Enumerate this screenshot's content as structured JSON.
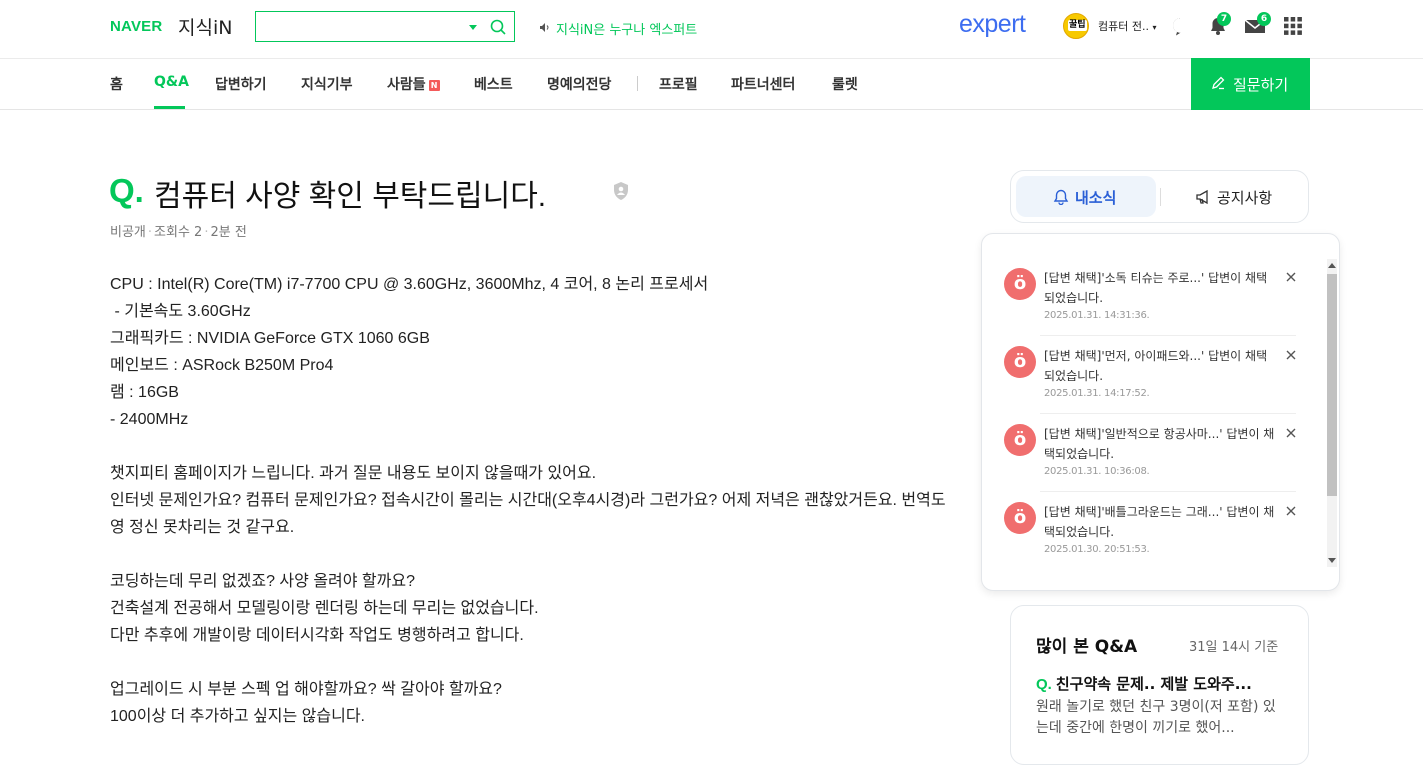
{
  "header": {
    "logo_naver": "NAVER",
    "logo_service": "지식iN",
    "search_placeholder": "",
    "notice": "지식iN은 누구나 엑스퍼트",
    "expert": "expert",
    "avatar_text": "꿀팁",
    "username": "컴퓨터 전..",
    "notification_count": "7",
    "mail_count": "6"
  },
  "nav": {
    "items": [
      "홈",
      "Q&A",
      "답변하기",
      "지식기부",
      "사람들",
      "베스트",
      "명예의전당",
      "프로필",
      "파트너센터",
      "룰렛"
    ],
    "new_badge": "N",
    "ask_button": "질문하기"
  },
  "question": {
    "mark": "Q.",
    "title": "컴퓨터 사양 확인 부탁드립니다.",
    "visibility": "비공개",
    "views": "조회수 2",
    "time": "2분 전",
    "body": [
      "CPU : Intel(R) Core(TM) i7-7700 CPU @ 3.60GHz, 3600Mhz, 4 코어, 8 논리 프로세서",
      " - 기본속도 3.60GHz",
      "그래픽카드 : NVIDIA GeForce GTX 1060 6GB",
      "메인보드 : ASRock B250M Pro4",
      "램 : 16GB",
      "- 2400MHz",
      "",
      "챗지피티 홈페이지가 느립니다. 과거 질문 내용도 보이지 않을때가 있어요.",
      "인터넷 문제인가요? 컴퓨터 문제인가요? 접속시간이 몰리는 시간대(오후4시경)라 그런가요? 어제 저녁은 괜찮았거든요. 번역도 영 정신 못차리는 것 같구요.",
      "",
      "코딩하는데 무리 없겠죠? 사양 올려야 할까요?",
      "건축설계 전공해서 모델링이랑 렌더링 하는데 무리는 없었습니다.",
      "다만 추후에 개발이랑 데이터시각화 작업도 병행하려고 합니다.",
      "",
      "업그레이드 시 부분 스펙 업 해야할까요? 싹 갈아야 할까요?",
      "100이상 더 추가하고 싶지는 않습니다."
    ]
  },
  "sidebar": {
    "tab_news": "내소식",
    "tab_notice": "공지사항",
    "notifications": [
      {
        "text": "[답변 채택]'소독 티슈는 주로...' 답변이 채택되었습니다.",
        "time": "2025.01.31. 14:31:36."
      },
      {
        "text": "[답변 채택]'먼저, 아이패드와...' 답변이 채택되었습니다.",
        "time": "2025.01.31. 14:17:52."
      },
      {
        "text": "[답변 채택]'일반적으로 항공사마...' 답변이 채택되었습니다.",
        "time": "2025.01.31. 10:36:08."
      },
      {
        "text": "[답변 채택]'배틀그라운드는 그래...' 답변이 채택되었습니다.",
        "time": "2025.01.30. 20:51:53."
      }
    ],
    "noti_icon_char": "ö",
    "popular": {
      "title": "많이 본 Q&A",
      "date": "31일 14시 기준",
      "q_mark": "Q.",
      "q_title": "친구약속 문제.. 제발 도와주...",
      "q_body": "원래 놀기로 했던 친구 3명이(저 포함) 있는데 중간에 한명이 끼기로 했어..."
    }
  }
}
